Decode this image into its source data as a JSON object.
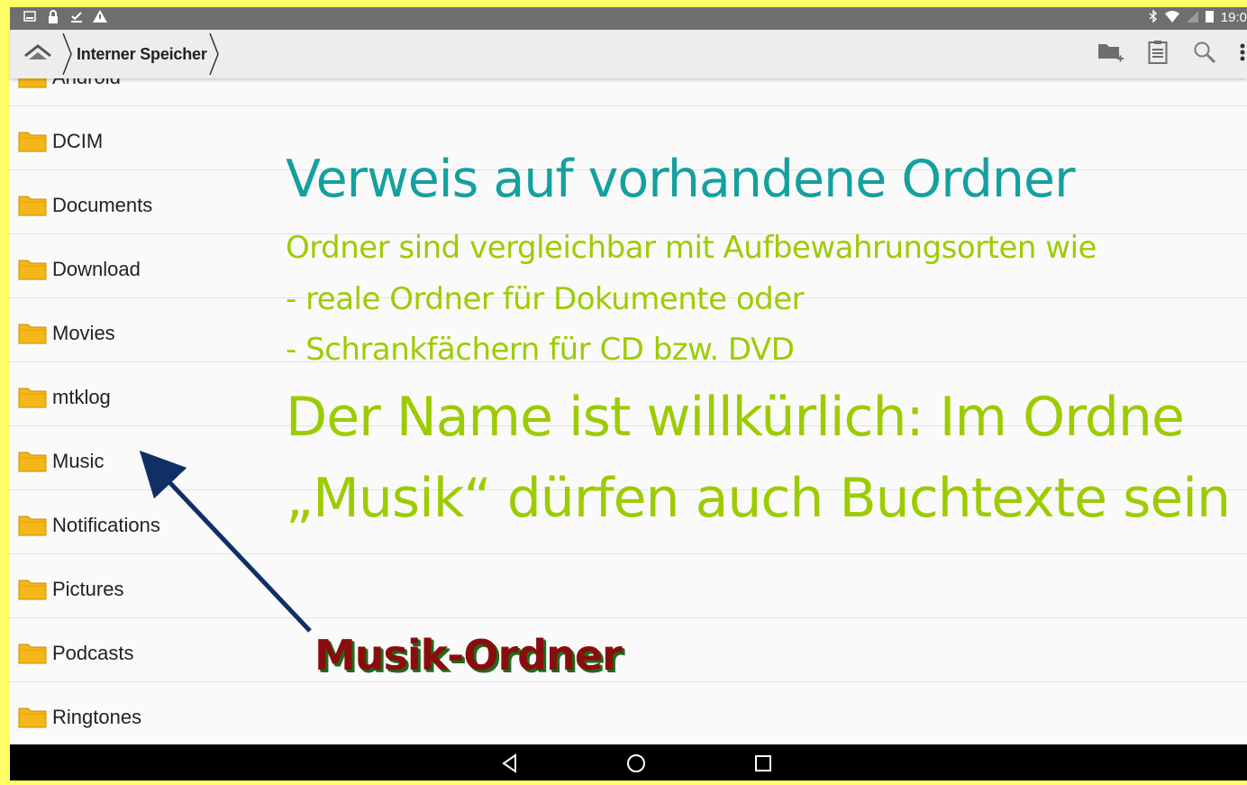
{
  "statusbar": {
    "left_icons": [
      "image-icon",
      "lock-icon",
      "download-done-icon",
      "warning-icon"
    ],
    "time": "19:0"
  },
  "toolbar": {
    "breadcrumb": "Interner Speicher"
  },
  "folders": [
    {
      "name": "Android"
    },
    {
      "name": "DCIM"
    },
    {
      "name": "Documents"
    },
    {
      "name": "Download"
    },
    {
      "name": "Movies"
    },
    {
      "name": "mtklog"
    },
    {
      "name": "Music"
    },
    {
      "name": "Notifications"
    },
    {
      "name": "Pictures"
    },
    {
      "name": "Podcasts"
    },
    {
      "name": "Ringtones"
    }
  ],
  "overlay": {
    "title": "Verweis auf vorhandene Ordner",
    "line1": "Ordner sind vergleichbar mit Aufbewahrungsorten wie",
    "line2": "- reale Ordner für Dokumente oder",
    "line3": "- Schrankfächern für CD bzw. DVD",
    "big1": "Der Name ist willkürlich: Im Ordne",
    "big2": "„Musik“ dürfen auch Buchtexte sein",
    "annotation": "Musik-Ordner"
  },
  "colors": {
    "frame": "#ffff66",
    "title": "#15a0a0",
    "green_text": "#9ccc00",
    "annotation": "#8a0d0d",
    "arrow": "#0f2f66"
  }
}
